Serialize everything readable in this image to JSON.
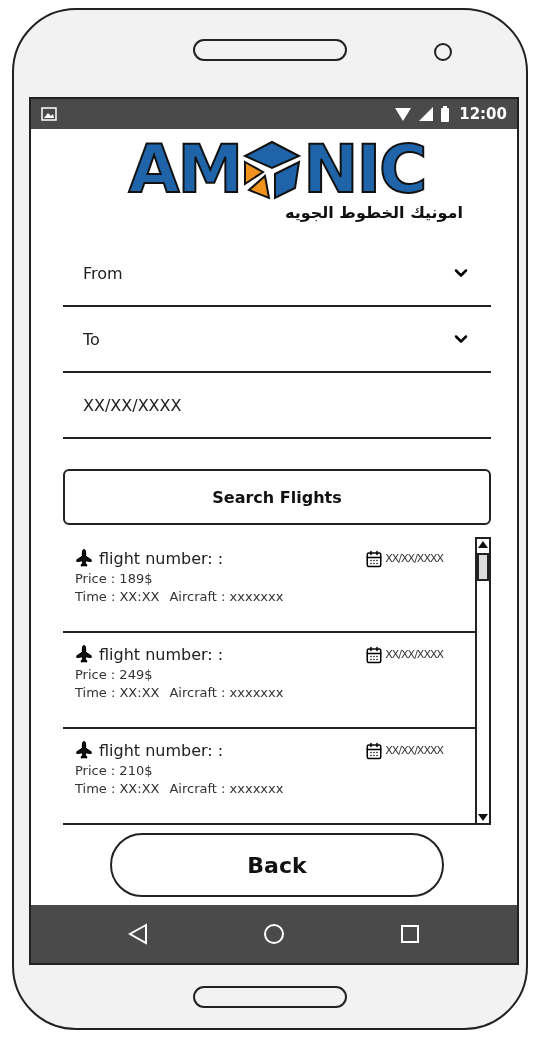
{
  "status_bar": {
    "time": "12:00"
  },
  "logo": {
    "left": "AM",
    "right": "NIC",
    "subtitle": "امونيك الخطوط الجويه"
  },
  "fields": [
    {
      "kind": "dropdown",
      "value": "From"
    },
    {
      "kind": "dropdown",
      "value": "To"
    },
    {
      "kind": "text",
      "value": "XX/XX/XXXX"
    }
  ],
  "search_button": "Search Flights",
  "flights": [
    {
      "flight_number": "flight number: :",
      "date": "XX/XX/XXXX",
      "price": "Price : 189$",
      "time": "Time : XX:XX",
      "aircraft": "Aircraft : xxxxxxx"
    },
    {
      "flight_number": "flight number: :",
      "date": "XX/XX/XXXX",
      "price": "Price : 249$",
      "time": "Time : XX:XX",
      "aircraft": "Aircraft : xxxxxxx"
    },
    {
      "flight_number": "flight number: :",
      "date": "XX/XX/XXXX",
      "price": "Price : 210$",
      "time": "Time : XX:XX",
      "aircraft": "Aircraft : xxxxxxx"
    }
  ],
  "back_button": "Back"
}
